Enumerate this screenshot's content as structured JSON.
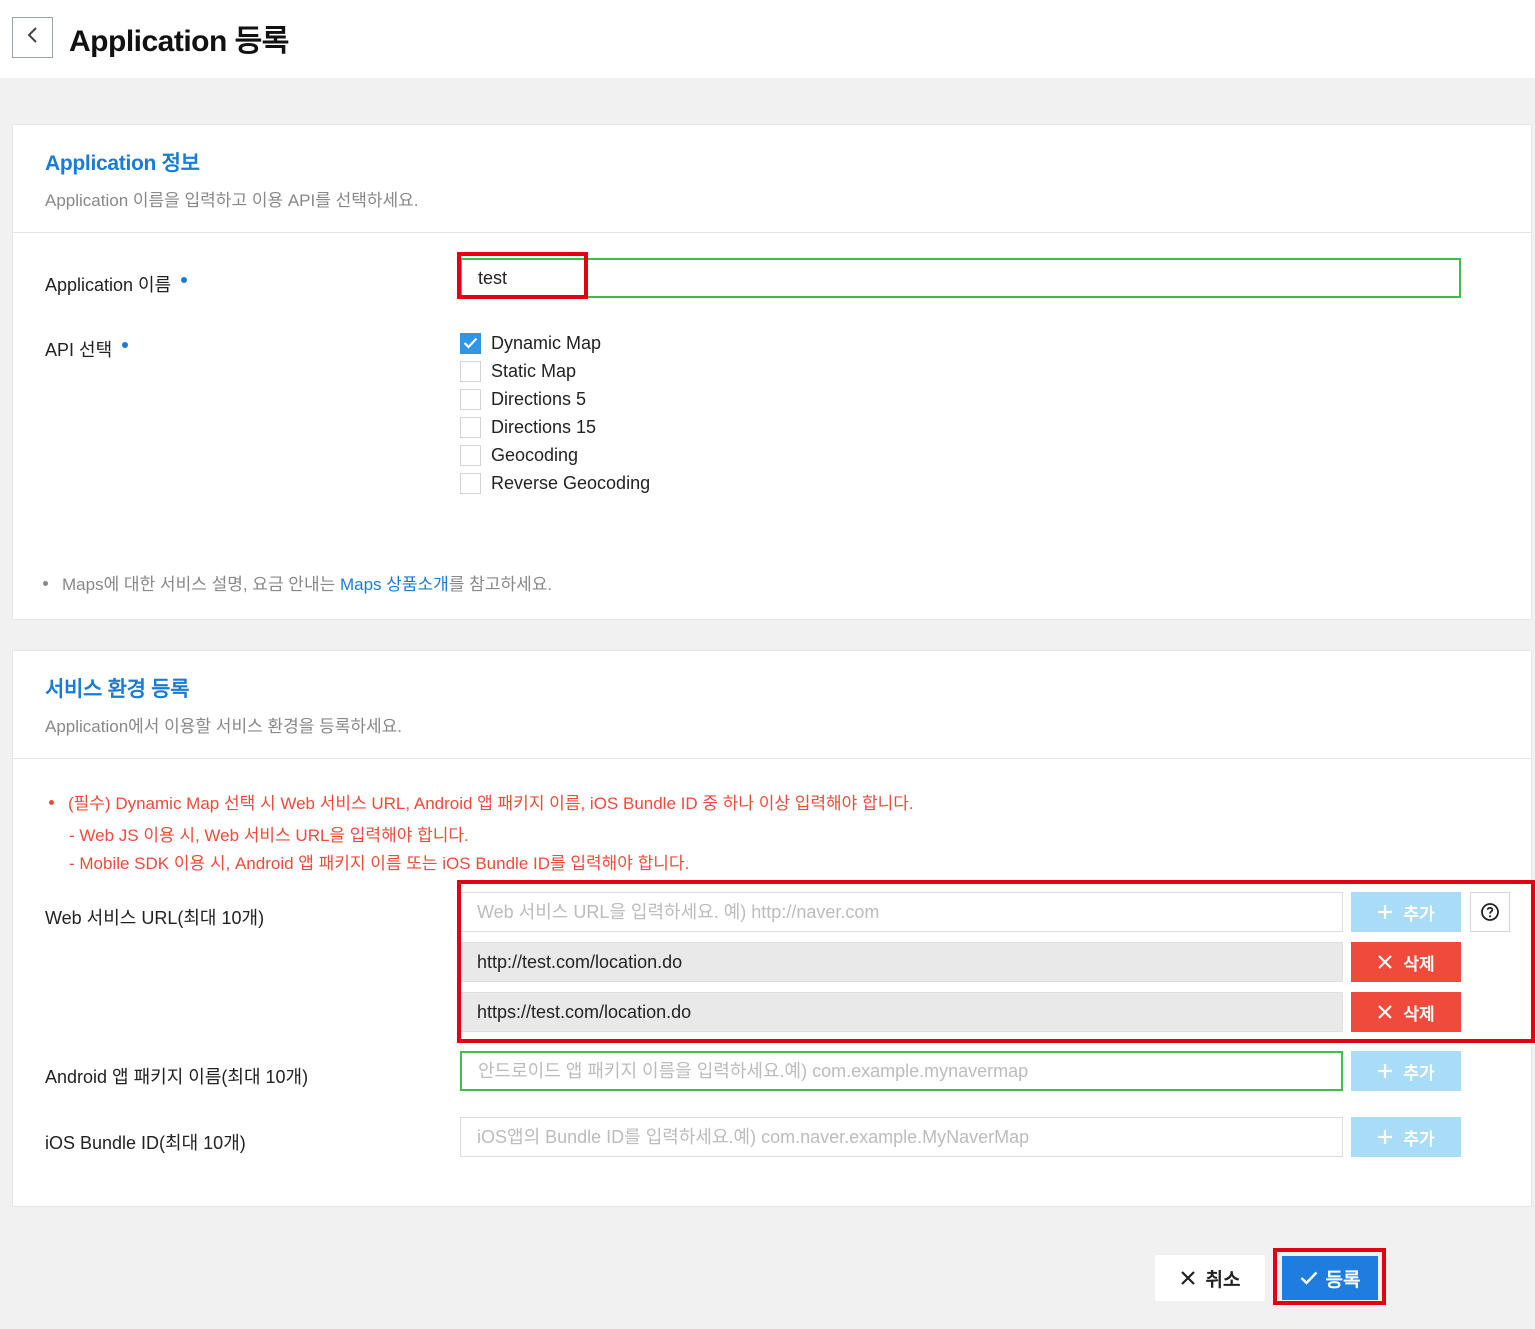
{
  "header": {
    "title": "Application 등록"
  },
  "app_info": {
    "title": "Application 정보",
    "description": "Application 이름을 입력하고 이용 API를 선택하세요.",
    "name_label": "Application 이름",
    "name_value": "test",
    "api_label": "API 선택",
    "apis": [
      {
        "label": "Dynamic Map",
        "checked": true
      },
      {
        "label": "Static Map",
        "checked": false
      },
      {
        "label": "Directions 5",
        "checked": false
      },
      {
        "label": "Directions 15",
        "checked": false
      },
      {
        "label": "Geocoding",
        "checked": false
      },
      {
        "label": "Reverse Geocoding",
        "checked": false
      }
    ],
    "note_prefix": "Maps에 대한 서비스 설명, 요금 안내는 ",
    "note_link": "Maps 상품소개",
    "note_suffix": "를 참고하세요."
  },
  "service_env": {
    "title": "서비스 환경 등록",
    "description": "Application에서 이용할 서비스 환경을 등록하세요.",
    "warning_main": "(필수) Dynamic Map 선택 시 Web 서비스 URL, Android 앱 패키지 이름, iOS Bundle ID 중 하나 이상 입력해야 합니다.",
    "warning_sub1": "- Web JS 이용 시, Web 서비스 URL을 입력해야 합니다.",
    "warning_sub2": "- Mobile SDK 이용 시, Android 앱 패키지 이름 또는 iOS Bundle ID를 입력해야 합니다.",
    "web_label": "Web 서비스 URL(최대 10개)",
    "web_placeholder": "Web 서비스 URL을 입력하세요. 예) http://naver.com",
    "web_urls": [
      "http://test.com/location.do",
      "https://test.com/location.do"
    ],
    "android_label": "Android 앱 패키지 이름(최대 10개)",
    "android_placeholder": "안드로이드 앱 패키지 이름을 입력하세요.예) com.example.mynavermap",
    "ios_label": "iOS Bundle ID(최대 10개)",
    "ios_placeholder": "iOS앱의 Bundle ID를 입력하세요.예) com.naver.example.MyNaverMap",
    "add_label": "추가",
    "delete_label": "삭제"
  },
  "footer": {
    "cancel_label": "취소",
    "submit_label": "등록"
  },
  "colors": {
    "accent": "#1a7bd6",
    "danger": "#ef4a3c",
    "add_disabled": "#a9dcf7",
    "highlight": "#e30012"
  }
}
